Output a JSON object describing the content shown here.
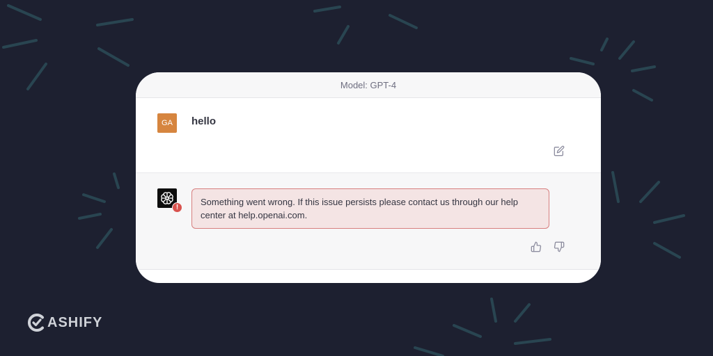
{
  "header": {
    "model_label": "Model: GPT-4"
  },
  "user_message": {
    "avatar_initials": "GA",
    "text": "hello"
  },
  "assistant_message": {
    "error_text": "Something went wrong. If this issue persists please contact us through our help center at help.openai.com."
  },
  "icons": {
    "edit": "pencil-edit-icon",
    "thumbs_up": "thumbs-up-icon",
    "thumbs_down": "thumbs-down-icon",
    "assistant": "openai-logo-icon",
    "error": "exclamation-icon"
  },
  "watermark": {
    "brand": "ASHIFY"
  },
  "colors": {
    "background": "#1d2030",
    "user_avatar": "#d6853f",
    "error_bg": "#f4e4e4",
    "error_border": "#d77f7f",
    "decor_lines": "#2c4f5a"
  }
}
